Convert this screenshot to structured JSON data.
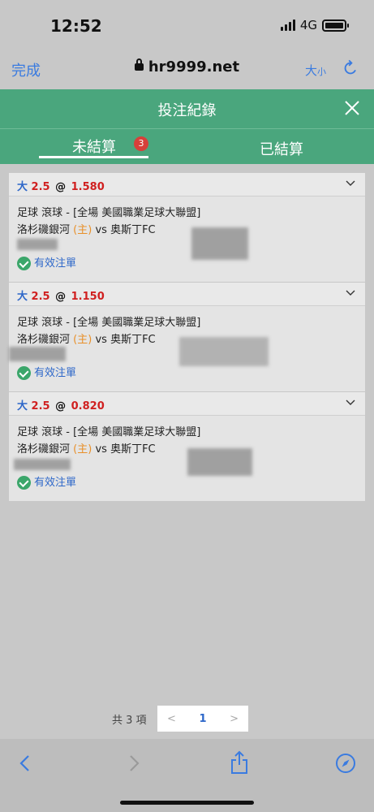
{
  "status_bar": {
    "time": "12:52",
    "network": "4G"
  },
  "browser": {
    "done_label": "完成",
    "url": "hr9999.net",
    "text_size_big": "大",
    "text_size_small": "小"
  },
  "modal": {
    "title": "投注紀錄",
    "tabs": [
      {
        "label": "未結算",
        "badge": "3"
      },
      {
        "label": "已結算"
      }
    ]
  },
  "bets": [
    {
      "selection": "大",
      "line": "2.5",
      "at": "@",
      "odds": "1.580",
      "event": "足球 滾球 - [全場 美國職業足球大聯盟]",
      "home_team": "洛杉磯銀河",
      "home_tag": "(主)",
      "vs": "vs",
      "away_team": "奥斯丁FC",
      "status": "有效注單"
    },
    {
      "selection": "大",
      "line": "2.5",
      "at": "@",
      "odds": "1.150",
      "event": "足球 滾球 - [全場 美國職業足球大聯盟]",
      "home_team": "洛杉磯銀河",
      "home_tag": "(主)",
      "vs": "vs",
      "away_team": "奥斯丁FC",
      "status": "有效注單"
    },
    {
      "selection": "大",
      "line": "2.5",
      "at": "@",
      "odds": "0.820",
      "event": "足球 滾球 - [全場 美國職業足球大聯盟]",
      "home_team": "洛杉磯銀河",
      "home_tag": "(主)",
      "vs": "vs",
      "away_team": "奥斯丁FC",
      "status": "有效注單"
    }
  ],
  "pagination": {
    "total": "共 3 項",
    "prev": "<",
    "page": "1",
    "next": ">"
  },
  "colors": {
    "header_green": "#4aa67d",
    "link_blue": "#2d67c9",
    "odds_red": "#d02020",
    "badge_red": "#d6403a",
    "home_orange": "#e8902a"
  }
}
